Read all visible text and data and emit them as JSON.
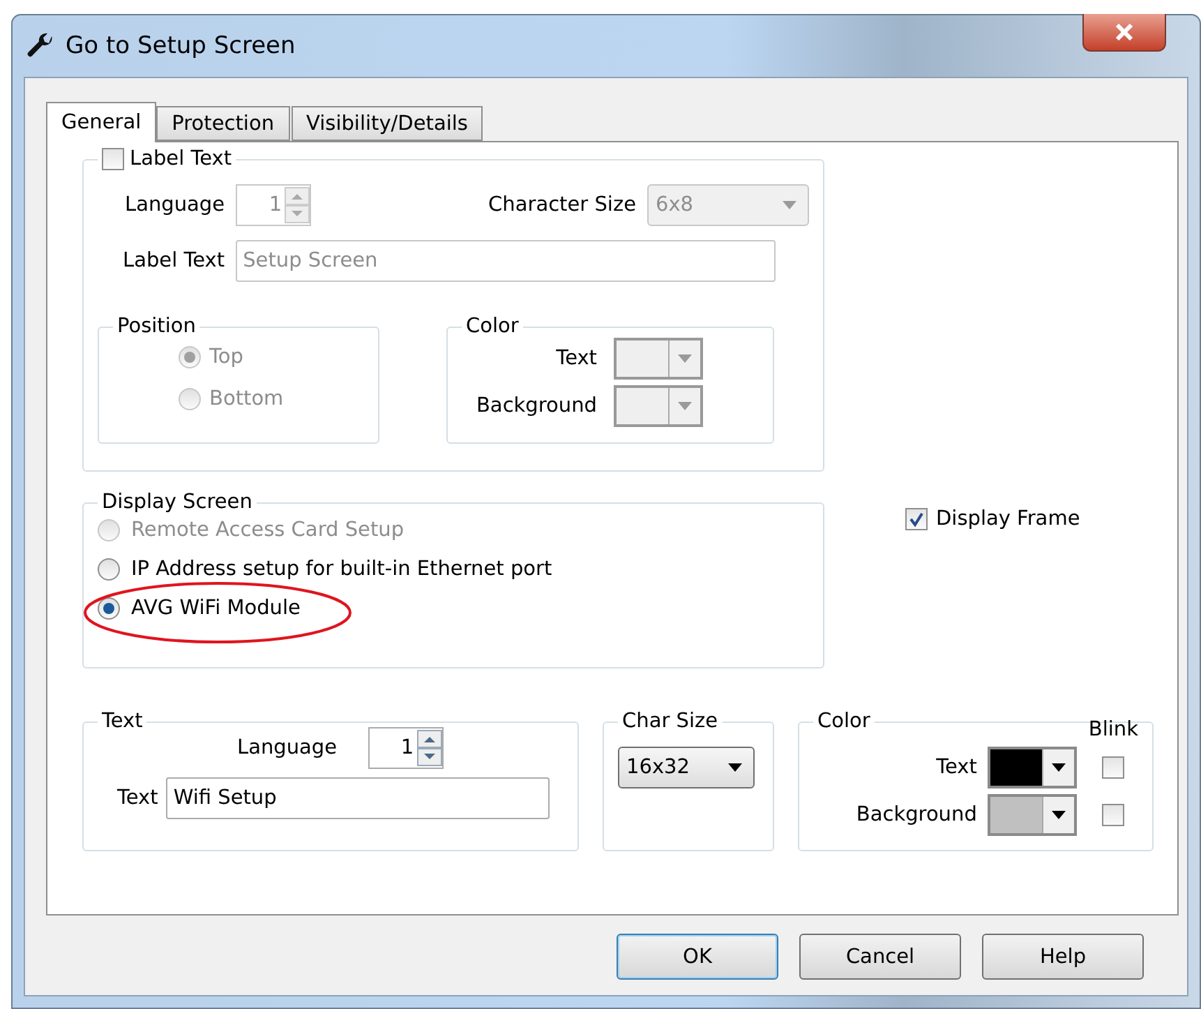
{
  "window": {
    "title": "Go to Setup Screen"
  },
  "tabs": [
    {
      "label": "General",
      "selected": true
    },
    {
      "label": "Protection",
      "selected": false
    },
    {
      "label": "Visibility/Details",
      "selected": false
    }
  ],
  "label_text_group": {
    "label": "Label Text",
    "checked": false,
    "disabled": true,
    "language_label": "Language",
    "language_value": "1",
    "char_size_label": "Character Size",
    "char_size_value": "6x8",
    "text_label": "Label Text",
    "text_value": "Setup Screen",
    "position": {
      "title": "Position",
      "options": [
        {
          "label": "Top",
          "selected": true
        },
        {
          "label": "Bottom",
          "selected": false
        }
      ]
    },
    "color": {
      "title": "Color",
      "rows": [
        {
          "label": "Text"
        },
        {
          "label": "Background"
        }
      ]
    }
  },
  "display_screen": {
    "title": "Display Screen",
    "options": [
      {
        "label": "Remote Access Card Setup",
        "selected": false,
        "disabled": true,
        "highlighted": false
      },
      {
        "label": "IP Address setup for built-in Ethernet port",
        "selected": false,
        "disabled": false,
        "highlighted": false
      },
      {
        "label": "AVG WiFi Module",
        "selected": true,
        "disabled": false,
        "highlighted": true
      }
    ]
  },
  "display_frame": {
    "label": "Display Frame",
    "checked": true
  },
  "text_group": {
    "title": "Text",
    "language_label": "Language",
    "language_value": "1",
    "text_label": "Text",
    "text_value": "Wifi Setup"
  },
  "char_size": {
    "title": "Char Size",
    "value": "16x32"
  },
  "color_group": {
    "title": "Color",
    "blink_label": "Blink",
    "rows": [
      {
        "label": "Text",
        "color": "#000000",
        "blink": false
      },
      {
        "label": "Background",
        "color": "#c0c0c0",
        "blink": false
      }
    ]
  },
  "buttons": [
    {
      "label": "OK",
      "default": true
    },
    {
      "label": "Cancel",
      "default": false
    },
    {
      "label": "Help",
      "default": false
    }
  ]
}
